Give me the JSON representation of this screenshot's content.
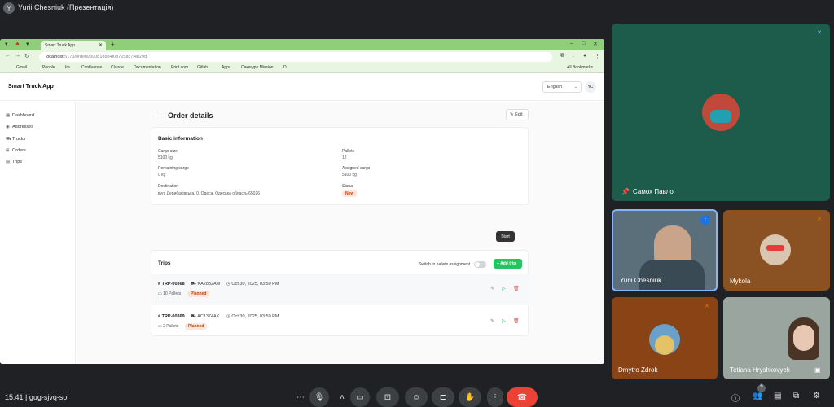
{
  "meet": {
    "presenter_title": "Yurii Chesniuk (Презентація)",
    "time": "15:41",
    "meeting_code": "gug-sjvq-sol",
    "participant_count": "6"
  },
  "browser": {
    "tab_title": "Smart Truck App",
    "url_host": "localhost",
    "url_path": ":5173/orders/890b188b4f0b725ac7f4b29d",
    "bookmarks": [
      "Gmail",
      "People",
      "Ira",
      "Confluence",
      "Claude",
      "Documentation",
      "Print.com",
      "Gitlab",
      "Apps",
      "Cакегуре Mission",
      "D"
    ],
    "all_bookmarks": "All Bookmarks"
  },
  "app": {
    "title": "Smart Truck App",
    "language": "English",
    "user_initials": "YC",
    "sidebar": [
      "Dashboard",
      "Addresses",
      "Trucks",
      "Orders",
      "Trips"
    ],
    "page_title": "Order details",
    "edit_label": "Edit",
    "basic_info": {
      "title": "Basic information",
      "cargo_size_label": "Cargo size",
      "cargo_size": "5100 kg",
      "pallets_label": "Pallets",
      "pallets": "12",
      "remaining_label": "Remaining cargo",
      "remaining": "0 kg",
      "assigned_label": "Assigned cargo",
      "assigned": "5100 kg",
      "destination_label": "Destination",
      "destination": "вул. Дерибасівська, 0, Одеса, Одеська область 65026",
      "status_label": "Status",
      "status": "New"
    },
    "trips": {
      "title": "Trips",
      "toggle_label": "Switch to pallets assignment",
      "add_label": "+ Add trip",
      "tooltip": "Start",
      "rows": [
        {
          "id": "TRP-00368",
          "truck": "KA2832AM",
          "date": "Oct 30, 2025, 03:50 PM",
          "pallets": "10 Pallets",
          "status": "Planned"
        },
        {
          "id": "TRP-00369",
          "truck": "AC1374AK",
          "date": "Oct 30, 2025, 03:50 PM",
          "pallets": "2 Pallets",
          "status": "Planned"
        }
      ]
    }
  },
  "participants": [
    {
      "name": "Самох Павло"
    },
    {
      "name": "Yurii Chesniuk"
    },
    {
      "name": "Mykola"
    },
    {
      "name": "Dmytro Zdrok"
    },
    {
      "name": "Tetiana Hryshkovych"
    }
  ],
  "colors": {
    "meet_bg": "#202124",
    "tab_green": "#8fcf7a",
    "add_trip_green": "#22c55e",
    "hangup_red": "#ea4335",
    "badge_orange_bg": "#fde6d8"
  }
}
